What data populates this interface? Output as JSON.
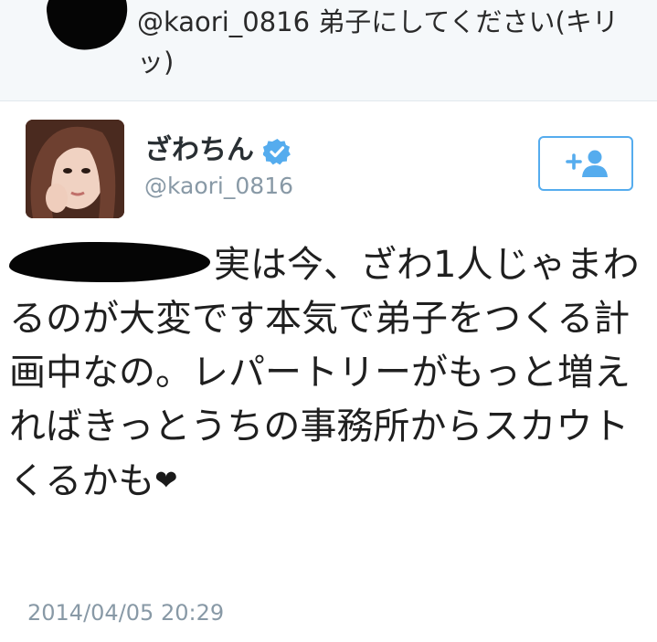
{
  "previous_tweet": {
    "text": "@kaori_0816 弟子にしてください(キリッ)"
  },
  "tweet": {
    "display_name": "ざわちん",
    "username": "@kaori_0816",
    "verified": true,
    "body_text": "実は今、ざわ1人じゃまわるのが大変です本気で弟子をつくる計画中なの。レパートリーがもっと増えればきっとうちの事務所からスカウトくるかも",
    "heart": "❤",
    "timestamp": "2014/04/05 20:29",
    "follow_icon": "add-user-icon"
  },
  "colors": {
    "accent": "#55acee",
    "muted": "#8899a6",
    "text": "#1f1f1f",
    "previous_bg": "#f5f8fa"
  }
}
